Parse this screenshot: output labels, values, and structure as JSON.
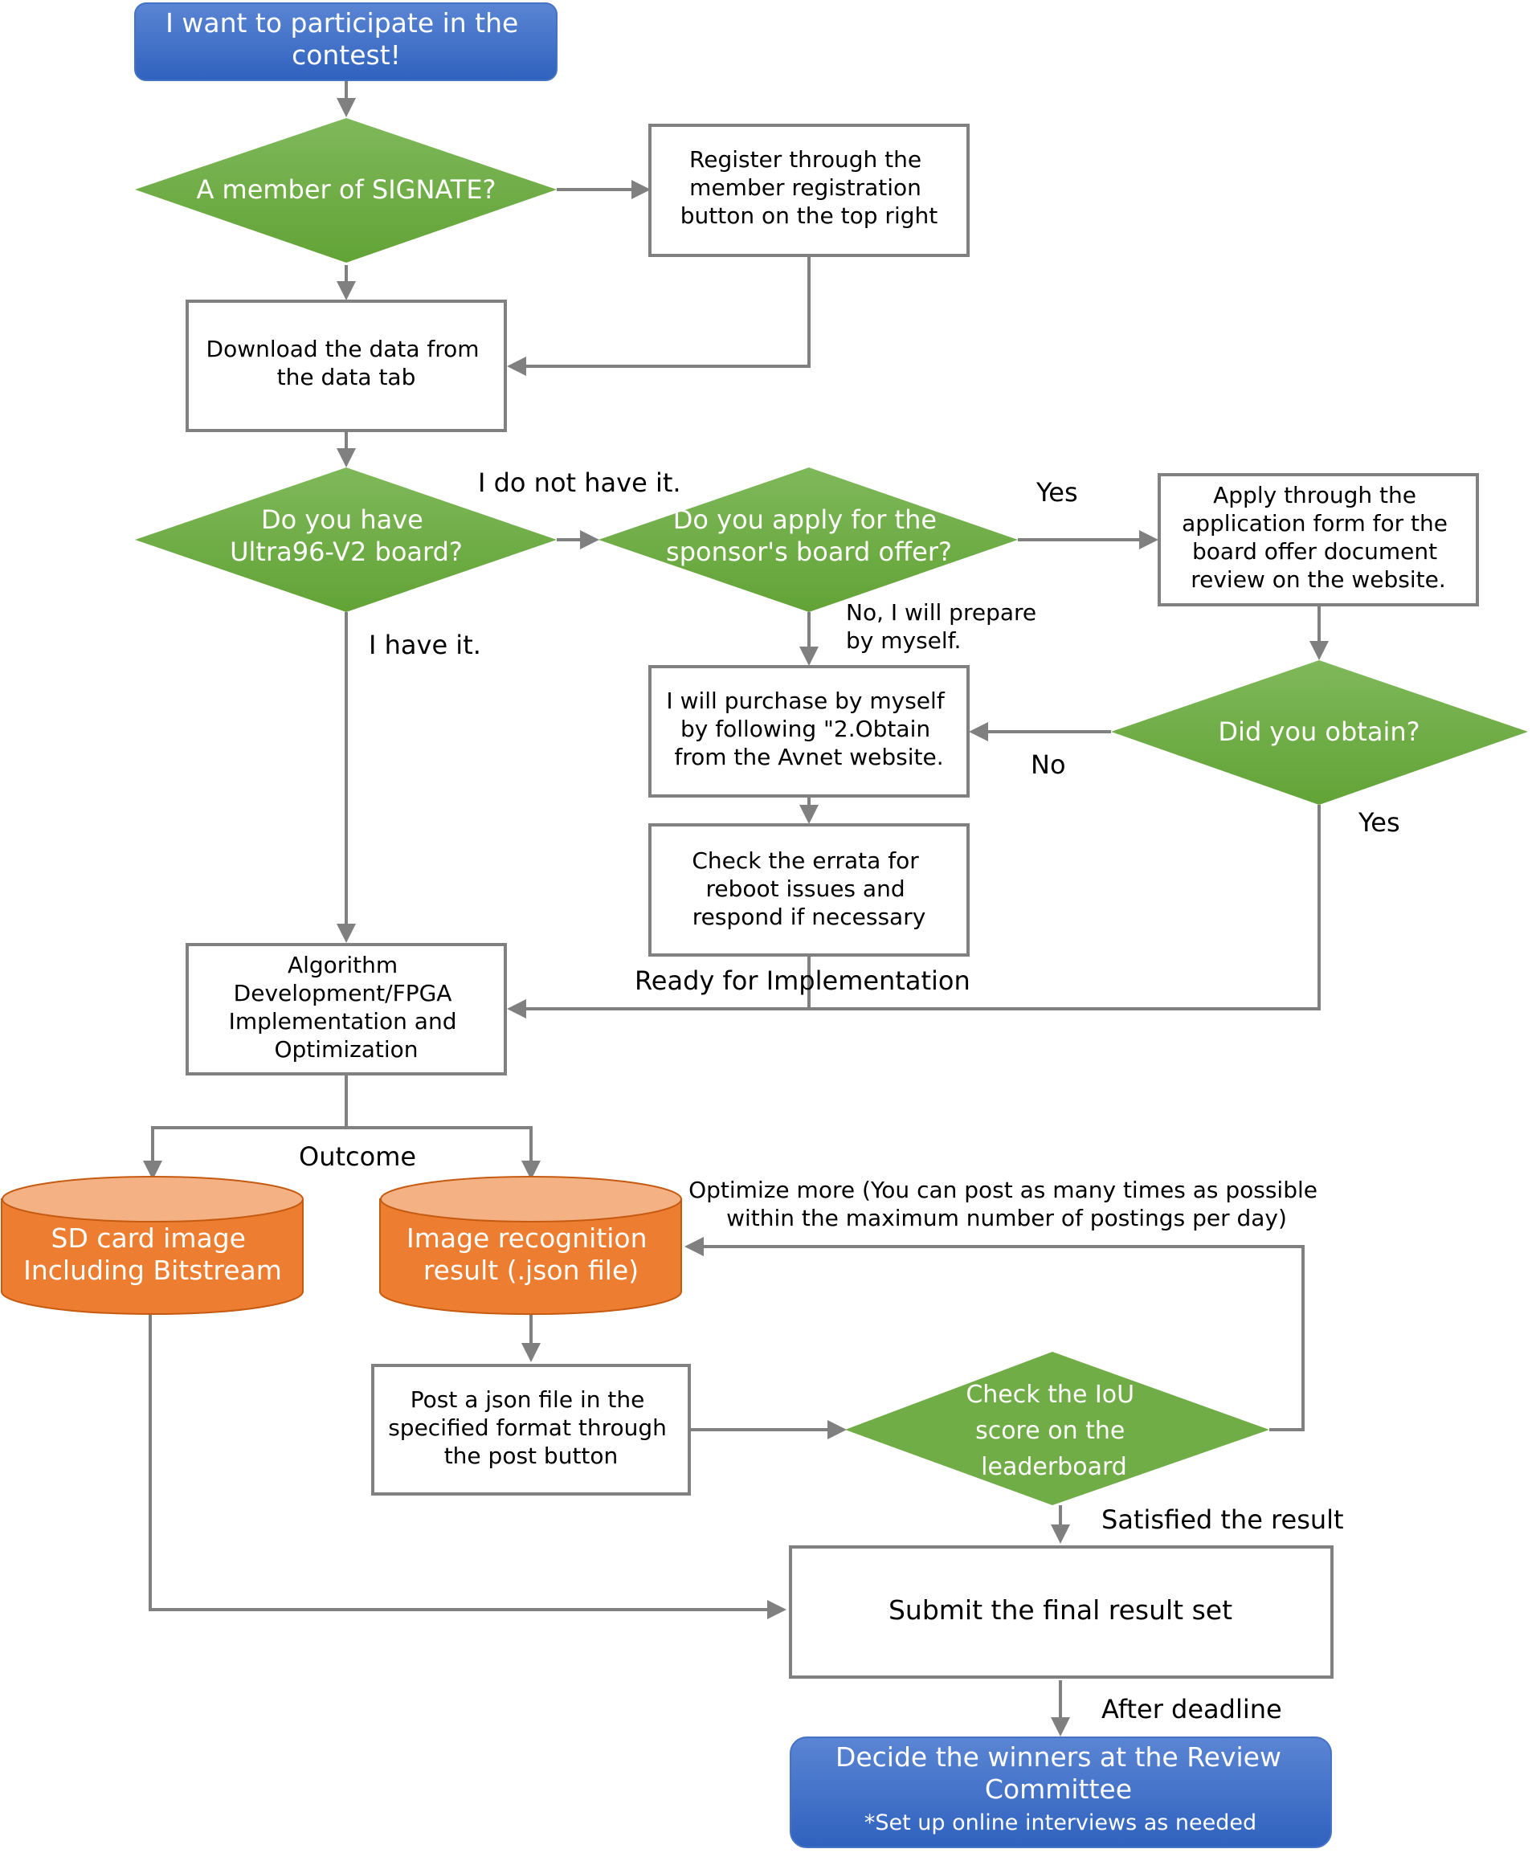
{
  "colors": {
    "terminal_blue": "#4472C4",
    "decision_green": "#70AD47",
    "data_orange": "#ED7D31",
    "data_orange_top": "#F4B183",
    "connector_gray": "#808080"
  },
  "nodes": {
    "start": [
      "I want to participate in the",
      "contest!"
    ],
    "member_q": [
      "A member of SIGNATE?"
    ],
    "register": [
      "Register through the",
      "member registration",
      "button on the top right"
    ],
    "download": [
      "Download the data from",
      "the data tab"
    ],
    "have_board_q": [
      "Do you have",
      "Ultra96-V2 board?"
    ],
    "apply_q": [
      "Do you apply for the",
      "sponsor's board offer?"
    ],
    "apply_form": [
      "Apply through the",
      "application form for the",
      "board offer document",
      "review on the website."
    ],
    "purchase": [
      "I will purchase by myself",
      "by  following \"2.Obtain",
      "from the Avnet website."
    ],
    "obtain_q": [
      "Did you obtain?"
    ],
    "errata": [
      "Check the errata for",
      "reboot issues and",
      "respond if necessary"
    ],
    "algorithm": [
      "Algorithm",
      "Development/FPGA",
      "Implementation and",
      "Optimization"
    ],
    "sd_card": [
      "SD card image",
      "Including Bitstream"
    ],
    "image_result": [
      "Image recognition",
      "result (.json file)"
    ],
    "post_json": [
      "Post a json file in the",
      "specified format through",
      "the post button"
    ],
    "iou_q": [
      "Check the IoU",
      "score on the",
      "leaderboard"
    ],
    "submit": [
      "Submit the final result set"
    ],
    "decide": [
      "Decide the winners at the Review",
      "Committee",
      "*Set up online interviews as needed"
    ]
  },
  "labels": {
    "no_board": "I do not have it.",
    "have_board": "I have it.",
    "apply_yes": "Yes",
    "apply_no": [
      "No, I will prepare",
      "by myself."
    ],
    "obtain_no": "No",
    "obtain_yes": "Yes",
    "ready": "Ready for Implementation",
    "outcome": "Outcome",
    "optimize": [
      "Optimize more (You can post as many times as possible",
      "within the maximum number of postings per day)"
    ],
    "satisfied": "Satisfied the result",
    "after_deadline": "After deadline"
  }
}
